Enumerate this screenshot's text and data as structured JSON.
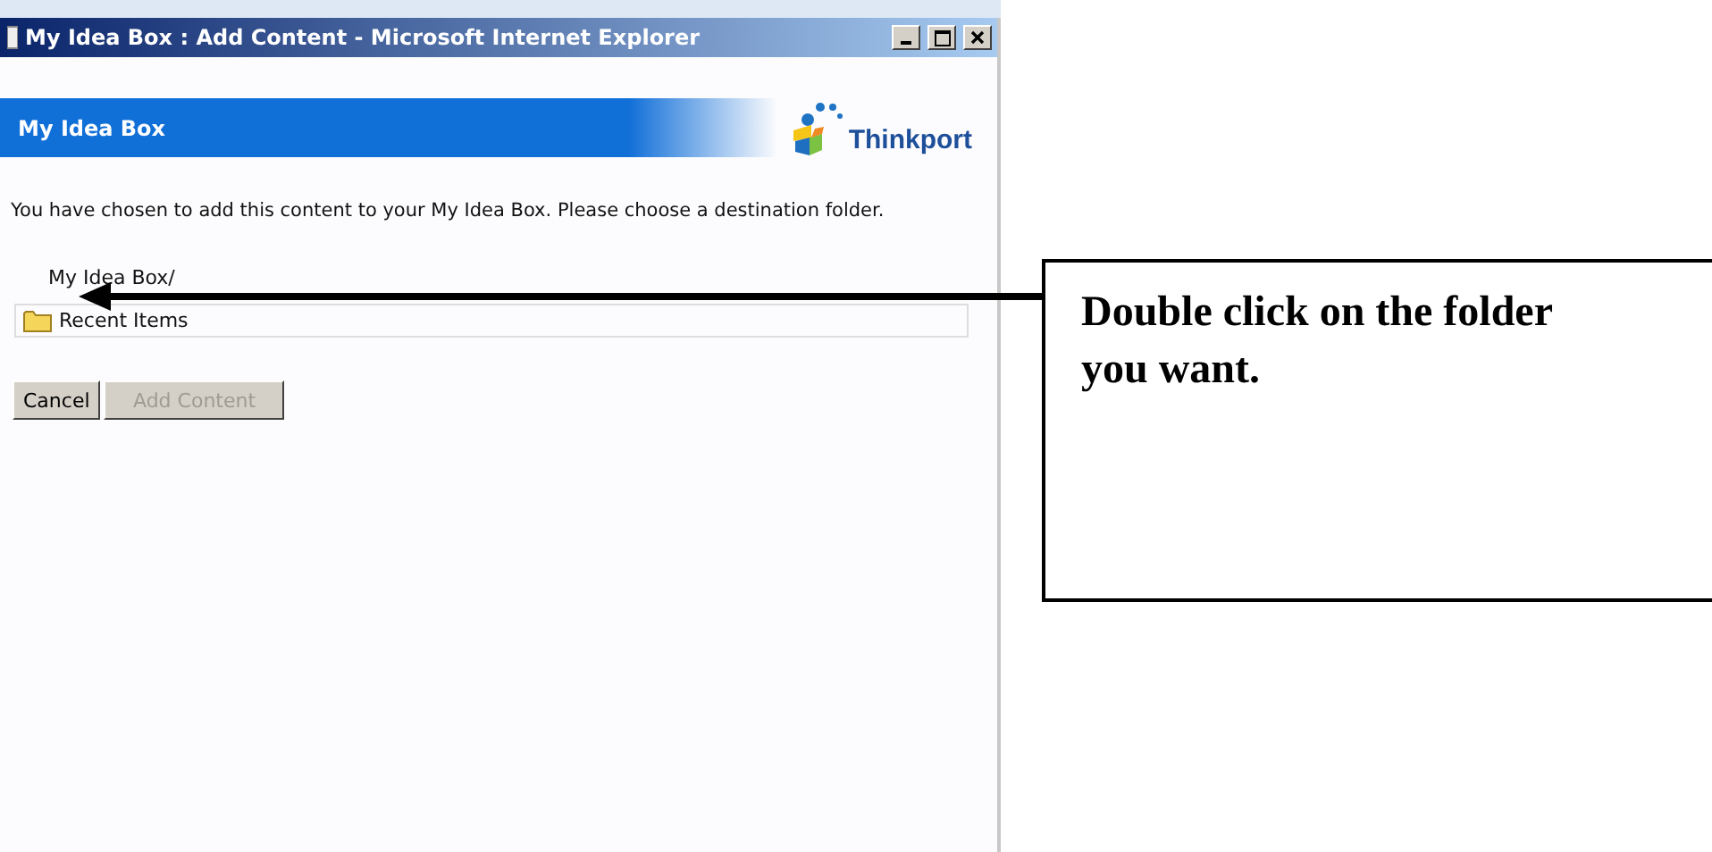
{
  "window": {
    "title": "My Idea Box : Add Content - Microsoft Internet Explorer"
  },
  "banner": {
    "title": "My Idea Box",
    "logo_text": "Thinkport"
  },
  "message": "You have chosen to add this content to your My Idea Box. Please choose a destination folder.",
  "path": "My Idea Box/",
  "folders": [
    {
      "name": "Recent Items"
    }
  ],
  "buttons": [
    {
      "label": "Cancel",
      "disabled": false
    },
    {
      "label": "Add Content",
      "disabled": true
    }
  ],
  "callout": {
    "text": "Double click on the folder you want."
  }
}
